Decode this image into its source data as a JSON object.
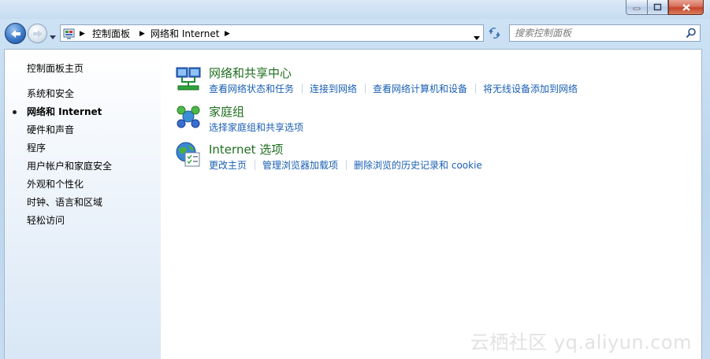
{
  "window": {
    "buttons": [
      "minimize",
      "maximize",
      "close"
    ]
  },
  "nav": {
    "breadcrumb": [
      "控制面板",
      "网络和 Internet"
    ],
    "search_placeholder": "搜索控制面板"
  },
  "sidebar": {
    "home": "控制面板主页",
    "items": [
      {
        "label": "系统和安全",
        "active": false
      },
      {
        "label": "网络和 Internet",
        "active": true
      },
      {
        "label": "硬件和声音",
        "active": false
      },
      {
        "label": "程序",
        "active": false
      },
      {
        "label": "用户帐户和家庭安全",
        "active": false
      },
      {
        "label": "外观和个性化",
        "active": false
      },
      {
        "label": "时钟、语言和区域",
        "active": false
      },
      {
        "label": "轻松访问",
        "active": false
      }
    ]
  },
  "categories": [
    {
      "icon": "network-sharing-icon",
      "title": "网络和共享中心",
      "links": [
        "查看网络状态和任务",
        "连接到网络",
        "查看网络计算机和设备",
        "将无线设备添加到网络"
      ]
    },
    {
      "icon": "homegroup-icon",
      "title": "家庭组",
      "links": [
        "选择家庭组和共享选项"
      ]
    },
    {
      "icon": "internet-options-icon",
      "title": "Internet 选项",
      "links": [
        "更改主页",
        "管理浏览器加载项",
        "删除浏览的历史记录和 cookie"
      ]
    }
  ],
  "watermark": "云栖社区 yq.aliyun.com",
  "colors": {
    "link": "#1a5fb4",
    "category_title": "#1f6e1f",
    "sidebar_gradient_end": "#d9e7f6"
  }
}
